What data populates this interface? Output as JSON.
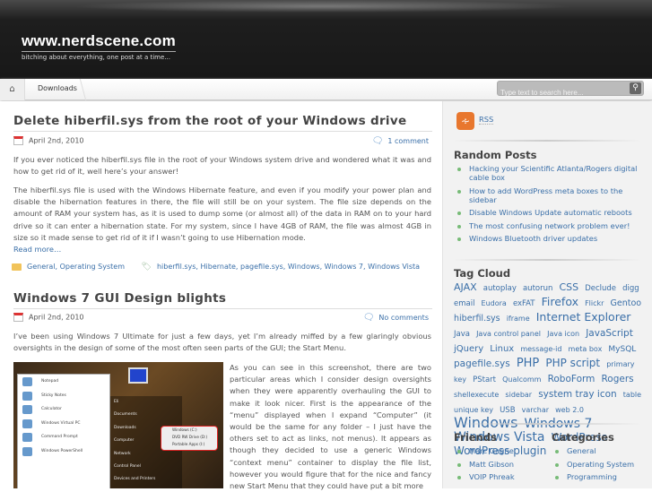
{
  "header": {
    "site_title": "www.nerdscene.com",
    "tagline": "bitching about everything, one post at a time..."
  },
  "nav": {
    "home_icon": "home-icon",
    "items": [
      "Downloads"
    ],
    "search_placeholder": "Type text to search here...",
    "search_icon": "magnifier-icon"
  },
  "posts": [
    {
      "title": "Delete hiberfil.sys from the root of your Windows drive",
      "date": "April 2nd, 2010",
      "comments": "1 comment",
      "paragraphs": [
        "If you ever noticed the hiberfil.sys file in the root of your Windows system drive and wondered what it was and how to get rid of it, well here’s your answer!",
        "The hiberfil.sys file is used with the Windows Hibernate feature, and even if you modify your power plan and disable the hibernation features in there, the file will still be on your system. The file size depends on the amount of RAM your system has, as it is used to dump some (or almost all) of the data in RAM on to your hard drive so it can enter a hibernation state. For my system, since I have 4GB of RAM, the file was almost 4GB in size so it made sense to get rid of it if I wasn’t going to use Hibernation mode."
      ],
      "read_more": "Read more…",
      "categories": "General, Operating System",
      "tags": "hiberfil.sys, Hibernate, pagefile.sys, Windows, Windows 7, Windows Vista"
    },
    {
      "title": "Windows 7 GUI Design blights",
      "date": "April 2nd, 2010",
      "comments": "No comments",
      "intro": "I’ve been using Windows 7 Ultimate for just a few days, yet I’m already miffed by a few glaringly obvious oversights in the design of some of the most often seen parts of the GUI; the Start Menu.",
      "body": "As you can see in this screenshot, there are two particular areas which I consider design oversights when they were apparently overhauling the GUI to make it look nicer. First is the appearance of the “menu” displayed when I expand “Computer” (it would be the same for any folder – I just have the others set to act as links, not menus). It appears as though they decided to use a generic Windows “context menu” container to display the file list, however you would figure that for the nice and fancy new Start Menu that they could have put a bit more",
      "screenshot": {
        "left_items": [
          "Notepad",
          "Sticky Notes",
          "Calculator",
          "Windows Virtual PC",
          "Command Prompt",
          "Windows PowerShell"
        ],
        "right_items": [
          "Eli",
          "Documents",
          "Downloads",
          "Computer",
          "Network",
          "Control Panel",
          "Devices and Printers"
        ],
        "context_items": [
          "Windows (C:)",
          "DVD RW Drive (D:)",
          "Portable Apps (I:)"
        ]
      }
    }
  ],
  "sidebar": {
    "rss": "RSS",
    "random_title": "Random Posts",
    "random_posts": [
      "Hacking your Scientific Atlanta/Rogers digital cable box",
      "How to add WordPress meta boxes to the sidebar",
      "Disable Windows Update automatic reboots",
      "The most confusing network problem ever!",
      "Windows Bluetooth driver updates"
    ],
    "tag_title": "Tag Cloud",
    "tags": [
      [
        "AJAX",
        11
      ],
      [
        "autoplay",
        8.5
      ],
      [
        "autorun",
        8.5
      ],
      [
        "CSS",
        11
      ],
      [
        "Declude",
        8.5
      ],
      [
        "digg",
        8.5
      ],
      [
        "email",
        8.5
      ],
      [
        "Eudora",
        8
      ],
      [
        "exFAT",
        8.5
      ],
      [
        "Firefox",
        12.5
      ],
      [
        "Flickr",
        8
      ],
      [
        "Gentoo",
        9.5
      ],
      [
        "hiberfil.sys",
        9.5
      ],
      [
        "iframe",
        8
      ],
      [
        "Internet Explorer",
        12.5
      ],
      [
        "Java",
        8.5
      ],
      [
        "Java control panel",
        8
      ],
      [
        "Java icon",
        8
      ],
      [
        "JavaScript",
        10.5
      ],
      [
        "jQuery",
        10
      ],
      [
        "Linux",
        10
      ],
      [
        "message-id",
        8
      ],
      [
        "meta box",
        8
      ],
      [
        "MySQL",
        9
      ],
      [
        "pagefile.sys",
        10.5
      ],
      [
        "PHP",
        13
      ],
      [
        "PHP script",
        12
      ],
      [
        "primary key",
        8
      ],
      [
        "PStart",
        8.5
      ],
      [
        "Qualcomm",
        8
      ],
      [
        "RoboForm",
        10.5
      ],
      [
        "Rogers",
        10.5
      ],
      [
        "shellexecute",
        8
      ],
      [
        "sidebar",
        8
      ],
      [
        "system tray icon",
        10.5
      ],
      [
        "table",
        8
      ],
      [
        "unique key",
        8
      ],
      [
        "USB",
        8.5
      ],
      [
        "varchar",
        8
      ],
      [
        "web 2.0",
        8
      ],
      [
        "Windows",
        16
      ],
      [
        "Windows 7",
        14
      ],
      [
        "Windows Vista",
        14
      ],
      [
        "WordPress",
        12
      ],
      [
        "WordPress plugin",
        12
      ]
    ],
    "friends_title": "Friends",
    "friends": [
      "Marc Gagne",
      "Matt Gibson",
      "VOIP Phreak"
    ],
    "categories_title": "Categories",
    "categories": [
      "General",
      "Operating System",
      "Programming"
    ]
  }
}
